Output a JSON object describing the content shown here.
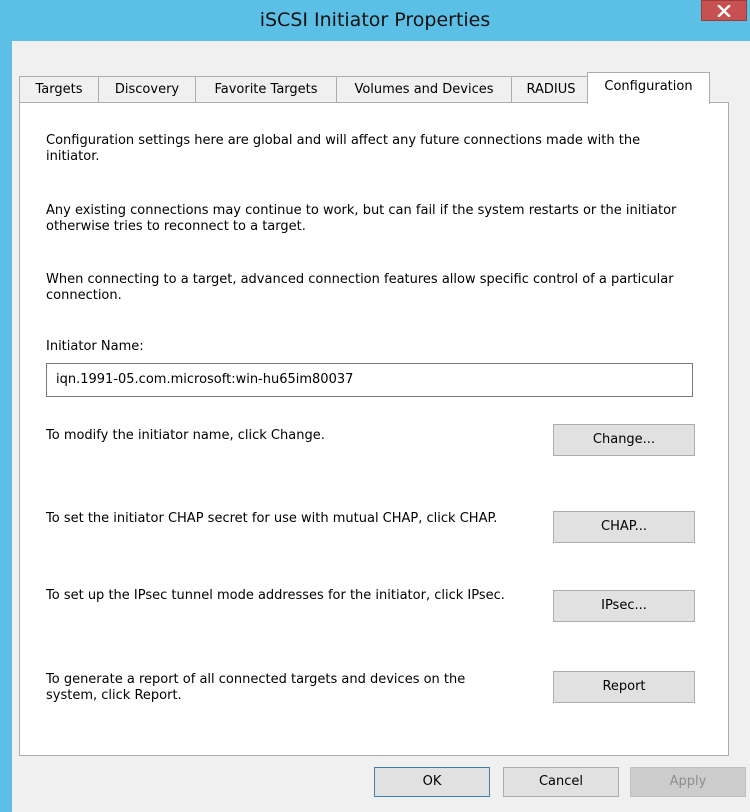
{
  "window": {
    "title": "iSCSI Initiator Properties",
    "close_glyph": "x"
  },
  "tabs": [
    {
      "label": "Targets"
    },
    {
      "label": "Discovery"
    },
    {
      "label": "Favorite Targets"
    },
    {
      "label": "Volumes and Devices"
    },
    {
      "label": "RADIUS"
    },
    {
      "label": "Configuration"
    }
  ],
  "active_tab": "Configuration",
  "configuration": {
    "intro_1": "Configuration settings here are global and will affect any future connections made with the initiator.",
    "intro_2": "Any existing connections may continue to work, but can fail if the system restarts or the initiator otherwise tries to reconnect to a target.",
    "intro_3": "When connecting to a target, advanced connection features allow specific control of a particular connection.",
    "initiator_name_label": "Initiator Name:",
    "initiator_name_value": "iqn.1991-05.com.microsoft:win-hu65im80037",
    "change_text": "To modify the initiator name, click Change.",
    "change_button": "Change...",
    "chap_text": "To set the initiator CHAP secret for use with mutual CHAP, click CHAP.",
    "chap_button": "CHAP...",
    "ipsec_text": "To set up the IPsec tunnel mode addresses for the initiator, click IPsec.",
    "ipsec_button": "IPsec...",
    "report_text": "To generate a report of all connected targets and devices on the system, click Report.",
    "report_button": "Report"
  },
  "footer": {
    "ok": "OK",
    "cancel": "Cancel",
    "apply": "Apply"
  },
  "colors": {
    "titlebar": "#5bbfe6",
    "close_button": "#c75050",
    "dialog_bg": "#f0f0f0",
    "panel_bg": "#ffffff"
  }
}
